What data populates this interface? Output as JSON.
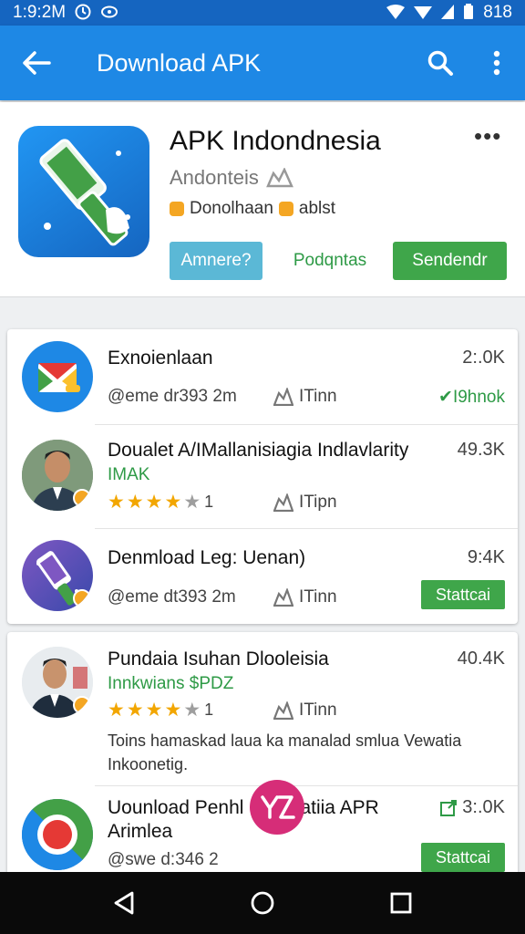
{
  "status_bar": {
    "time": "1:9:2M",
    "battery": "818"
  },
  "app_bar": {
    "title": "Download APK",
    "back_icon": "arrow-left-icon",
    "search_icon": "search-icon",
    "menu_icon": "more-vert-icon"
  },
  "header": {
    "title": "APK Indondnesia",
    "subtitle": "Andonteis",
    "meta": "Donolhaan",
    "meta2": "ablst",
    "more": "•••",
    "btn_install": "Amnere?",
    "btn_text": "Podqntas",
    "btn_green": "Sendendr"
  },
  "list1": [
    {
      "title": "Exnoienlaan",
      "size": "2:.0K",
      "meta": "@eme dr393 2m",
      "rank": "ITinn",
      "right_label": "✔I9hnok"
    },
    {
      "title": "Doualet A/IMallanisiagia Indlavlarity",
      "subtitle": "IMAK",
      "size": "49.3K",
      "rating_num": "1",
      "rank": "ITipn"
    },
    {
      "title": "Denmload Leg: Uenan)",
      "size": "9:4K",
      "meta": "@eme dt393 2m",
      "rank": "ITinn",
      "button": "Stattcai"
    }
  ],
  "list2": [
    {
      "title": "Pundaia Isuhan Dlooleisia",
      "subtitle": "Innkwians $PDZ",
      "size": "40.4K",
      "rating_num": "1",
      "rank": "ITinn",
      "description": "Toins hamaskad laua ka manalad smlua Vewatia Inkoonetig."
    },
    {
      "title": "Uounload Penhl",
      "title_tail": "atiia APR",
      "title_line2": "Arimlea",
      "size": "3:.0K",
      "meta": "@swe d:346 2",
      "button": "Stattcai"
    }
  ],
  "colors": {
    "app_bar": "#1e88e5",
    "status_bar": "#1565c0",
    "accent_green": "#3fa64a"
  }
}
